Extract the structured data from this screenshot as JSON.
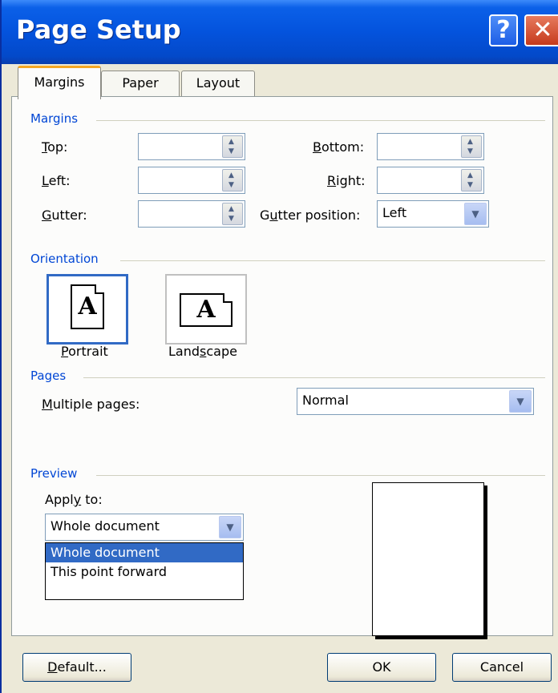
{
  "window": {
    "title": "Page Setup",
    "help_glyph": "?",
    "close_glyph": "✕"
  },
  "tabs": [
    {
      "label": "Margins",
      "active": true
    },
    {
      "label": "Paper",
      "active": false
    },
    {
      "label": "Layout",
      "active": false
    }
  ],
  "margins": {
    "group_title": "Margins",
    "top": {
      "label_u": "T",
      "label_rest": "op:",
      "value": ""
    },
    "bottom": {
      "label_u": "B",
      "label_rest": "ottom:",
      "value": ""
    },
    "left": {
      "label_u": "L",
      "label_rest": "eft:",
      "value": ""
    },
    "right": {
      "label_pre": "",
      "label_u": "R",
      "label_rest": "ight:",
      "value": ""
    },
    "gutter": {
      "label_u": "G",
      "label_rest": "utter:",
      "value": ""
    },
    "gutter_position": {
      "label_pre": "G",
      "label_u": "u",
      "label_rest": "tter position:",
      "value": "Left"
    }
  },
  "orientation": {
    "group_title": "Orientation",
    "portrait": {
      "label_u": "P",
      "label_rest": "ortrait",
      "glyph": "A",
      "selected": true
    },
    "landscape": {
      "label_pre": "Land",
      "label_u": "s",
      "label_rest": "cape",
      "glyph": "A",
      "selected": false
    }
  },
  "pages": {
    "group_title": "Pages",
    "multiple_label_u": "M",
    "multiple_label_rest": "ultiple pages:",
    "multiple_value": "Normal"
  },
  "preview": {
    "group_title": "Preview",
    "apply_label_pre": "Appl",
    "apply_label_u": "y",
    "apply_label_rest": " to:",
    "apply_value": "Whole document",
    "options": [
      "Whole document",
      "This point forward"
    ],
    "selected_option": "Whole document"
  },
  "buttons": {
    "default_u": "D",
    "default_rest": "efault...",
    "ok": "OK",
    "cancel": "Cancel"
  },
  "colors": {
    "title_bar": "#0453dd",
    "group_title": "#0046d5",
    "selection": "#316ac5",
    "tab_highlight": "#f5a623"
  }
}
